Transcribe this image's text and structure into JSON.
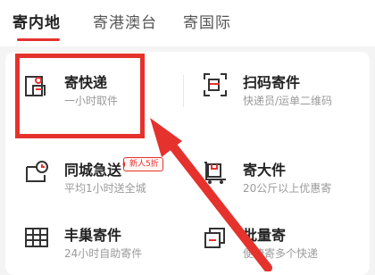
{
  "tabs": [
    {
      "label": "寄内地",
      "active": true
    },
    {
      "label": "寄港澳台",
      "active": false
    },
    {
      "label": "寄国际",
      "active": false
    }
  ],
  "services": [
    {
      "title": "寄快递",
      "subtitle": "一小时取件",
      "icon": "courier-person-icon"
    },
    {
      "title": "扫码寄件",
      "subtitle": "快递员/运单二维码",
      "icon": "scan-code-icon"
    },
    {
      "title": "同城急送",
      "subtitle": "平均1小时送全城",
      "icon": "clock-box-icon",
      "badge": "新人5折"
    },
    {
      "title": "寄大件",
      "subtitle": "20公斤以上优惠寄",
      "icon": "cart-box-icon"
    },
    {
      "title": "丰巢寄件",
      "subtitle": "24小时自助寄件",
      "icon": "locker-grid-icon"
    },
    {
      "title": "批量寄",
      "subtitle": "便捷寄多个快递",
      "icon": "stacked-pages-icon"
    }
  ],
  "colors": {
    "accent": "#e5322d",
    "icon_stroke": "#333333"
  }
}
